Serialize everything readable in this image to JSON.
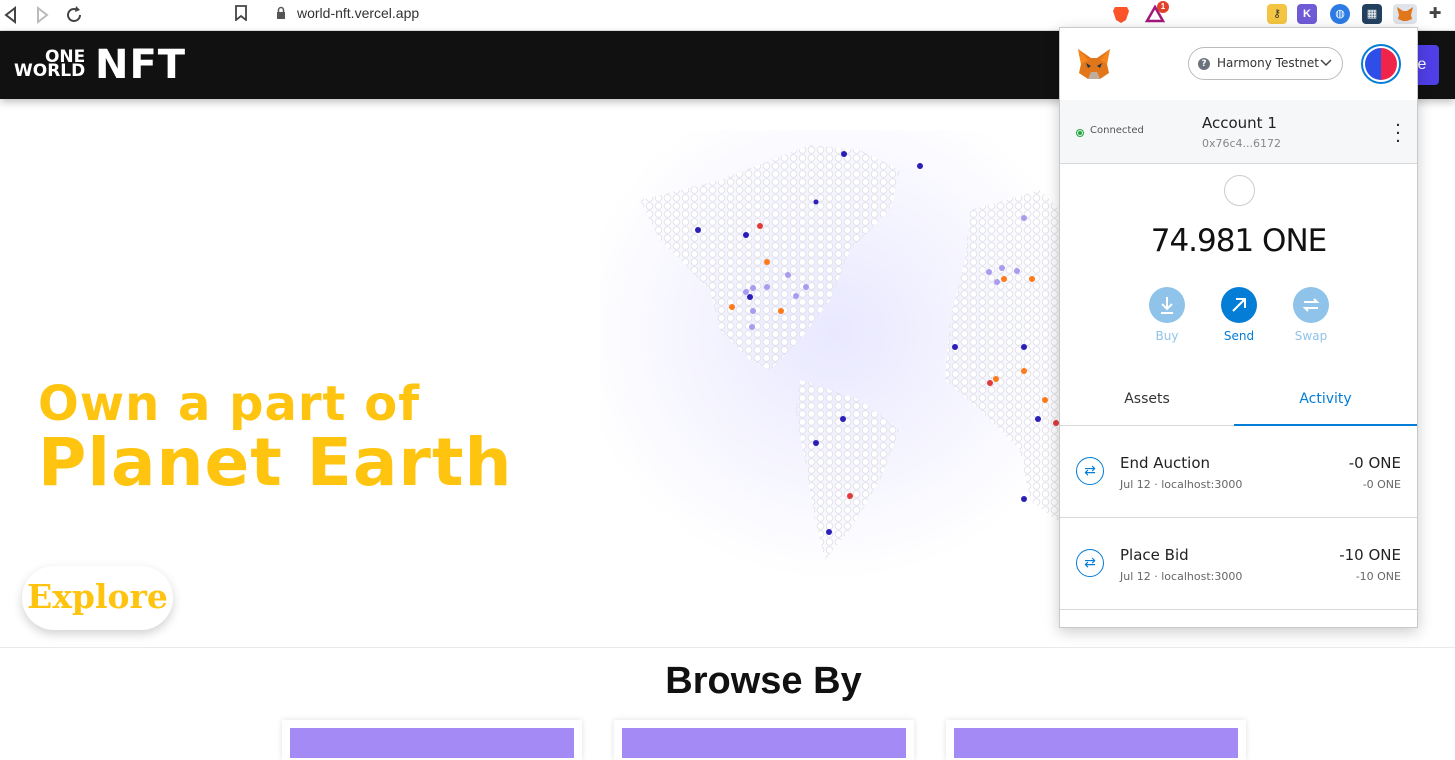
{
  "browser": {
    "url": "world-nft.vercel.app",
    "notification_badge": "1"
  },
  "site": {
    "logo_top": "ONE",
    "logo_bottom": "WORLD",
    "logo_big": "NFT",
    "header_button_fragment": "e",
    "hero_line1": "Own a part of",
    "hero_line2": "Planet Earth",
    "explore_label": "Explore",
    "browse_heading": "Browse By"
  },
  "metamask": {
    "network": "Harmony Testnet",
    "status": "Connected",
    "account_name": "Account 1",
    "account_address": "0x76c4...6172",
    "balance": "74.981 ONE",
    "actions": [
      {
        "label": "Buy",
        "icon": "download-icon"
      },
      {
        "label": "Send",
        "icon": "arrow-up-right-icon"
      },
      {
        "label": "Swap",
        "icon": "swap-icon"
      }
    ],
    "tabs": [
      "Assets",
      "Activity"
    ],
    "active_tab": "Activity",
    "transactions": [
      {
        "title": "End Auction",
        "subtitle": "Jul 12 · localhost:3000",
        "amount": "-0 ONE",
        "amount_sub": "-0 ONE"
      },
      {
        "title": "Place Bid",
        "subtitle": "Jul 12 · localhost:3000",
        "amount": "-10 ONE",
        "amount_sub": "-10 ONE"
      }
    ]
  },
  "colors": {
    "accent_yellow": "#ffc410",
    "metamask_blue": "#037dd6",
    "header_dark": "#111111",
    "card_purple": "#a38af5"
  }
}
